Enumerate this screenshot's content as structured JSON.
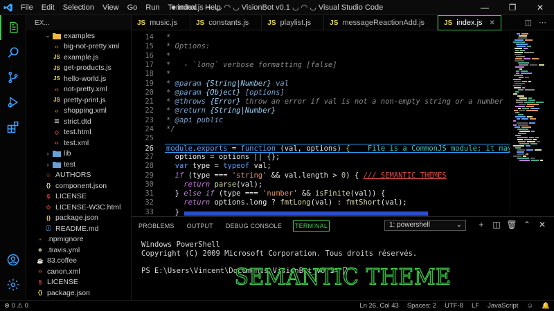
{
  "window": {
    "title": "● index.js — ◡ ◠ ◡ VisionBot v0.1 ◡ ◠ ◡ Visual Studio Code",
    "menu": [
      "File",
      "Edit",
      "Selection",
      "View",
      "Go",
      "Run",
      "Terminal",
      "Help"
    ]
  },
  "activity": {
    "items": [
      "files-icon",
      "search-icon",
      "source-control-icon",
      "run-debug-icon",
      "extensions-icon"
    ],
    "bottom": [
      "account-icon",
      "settings-gear-icon"
    ]
  },
  "explorer": {
    "header": "EX...",
    "rows": [
      {
        "label": "examples",
        "kind": "folder-open",
        "indent": 1
      },
      {
        "label": "big-not-pretty.xml",
        "kind": "xml",
        "indent": 2
      },
      {
        "label": "example.js",
        "kind": "js",
        "indent": 2
      },
      {
        "label": "get-products.js",
        "kind": "js",
        "indent": 2
      },
      {
        "label": "hello-world.js",
        "kind": "js",
        "indent": 2
      },
      {
        "label": "not-pretty.xml",
        "kind": "xml",
        "indent": 2
      },
      {
        "label": "pretty-print.js",
        "kind": "js",
        "indent": 2
      },
      {
        "label": "shopping.xml",
        "kind": "xml",
        "indent": 2
      },
      {
        "label": "strict.dtd",
        "kind": "dtd",
        "indent": 2
      },
      {
        "label": "test.html",
        "kind": "html",
        "indent": 2
      },
      {
        "label": "test.xml",
        "kind": "xml",
        "indent": 2
      },
      {
        "label": "lib",
        "kind": "folder",
        "indent": 1
      },
      {
        "label": "test",
        "kind": "folder",
        "indent": 1
      },
      {
        "label": "AUTHORS",
        "kind": "authors",
        "indent": 1
      },
      {
        "label": "component.json",
        "kind": "json",
        "indent": 1
      },
      {
        "label": "LICENSE",
        "kind": "license",
        "indent": 1
      },
      {
        "label": "LICENSE-W3C.html",
        "kind": "html",
        "indent": 1
      },
      {
        "label": "package.json",
        "kind": "json",
        "indent": 1
      },
      {
        "label": "README.md",
        "kind": "md",
        "indent": 1
      },
      {
        "label": ".npmignore",
        "kind": "npm",
        "indent": 0
      },
      {
        "label": ".travis.yml",
        "kind": "travis",
        "indent": 0
      },
      {
        "label": "83.coffee",
        "kind": "coffee",
        "indent": 0
      },
      {
        "label": "canon.xml",
        "kind": "xml",
        "indent": 0
      },
      {
        "label": "LICENSE",
        "kind": "license",
        "indent": 0
      },
      {
        "label": "package.json",
        "kind": "json",
        "indent": 0
      }
    ]
  },
  "tabs": [
    {
      "icon": "JS",
      "label": "music.js",
      "active": false
    },
    {
      "icon": "JS",
      "label": "constants.js",
      "active": false
    },
    {
      "icon": "JS",
      "label": "playlist.js",
      "active": false
    },
    {
      "icon": "JS",
      "label": "messageReactionAdd.js",
      "active": false
    },
    {
      "icon": "JS",
      "label": "index.js",
      "active": true
    }
  ],
  "editor": {
    "lines": [
      {
        "n": "14",
        "segs": [
          [
            "cm",
            "*"
          ]
        ]
      },
      {
        "n": "15",
        "segs": [
          [
            "cm",
            "* Options:"
          ]
        ]
      },
      {
        "n": "16",
        "segs": [
          [
            "cm",
            "*"
          ]
        ]
      },
      {
        "n": "17",
        "segs": [
          [
            "cm",
            "*   - `long` verbose formatting [false]"
          ]
        ]
      },
      {
        "n": "18",
        "segs": [
          [
            "cm",
            "*"
          ]
        ]
      },
      {
        "n": "19",
        "segs": [
          [
            "cm",
            "* "
          ],
          [
            "tg",
            "@param"
          ],
          [
            "cm",
            " "
          ],
          [
            "ty",
            "{String|Number}"
          ],
          [
            "cm",
            " "
          ],
          [
            "tg",
            "val"
          ]
        ]
      },
      {
        "n": "20",
        "segs": [
          [
            "cm",
            "* "
          ],
          [
            "tg",
            "@param"
          ],
          [
            "cm",
            " "
          ],
          [
            "ty",
            "{Object}"
          ],
          [
            "cm",
            " "
          ],
          [
            "tg",
            "[options]"
          ]
        ]
      },
      {
        "n": "21",
        "segs": [
          [
            "cm",
            "* "
          ],
          [
            "tg",
            "@throws"
          ],
          [
            "cm",
            " "
          ],
          [
            "ty",
            "{Error}"
          ],
          [
            "cm",
            " throw an error if val is not a non-empty string or a number"
          ]
        ]
      },
      {
        "n": "22",
        "segs": [
          [
            "cm",
            "* "
          ],
          [
            "tg",
            "@return"
          ],
          [
            "cm",
            " "
          ],
          [
            "ty",
            "{String|Number}"
          ]
        ]
      },
      {
        "n": "23",
        "segs": [
          [
            "cm",
            "* "
          ],
          [
            "tg",
            "@api"
          ],
          [
            "cm",
            " "
          ],
          [
            "tg",
            "public"
          ]
        ]
      },
      {
        "n": "24",
        "segs": [
          [
            "cm",
            "*/"
          ]
        ]
      },
      {
        "n": "25",
        "segs": []
      },
      {
        "n": "26",
        "cur": true,
        "segs": [
          [
            "kw",
            "module"
          ],
          [
            "id",
            "."
          ],
          [
            "kw",
            "exports"
          ],
          [
            "id",
            " = "
          ],
          [
            "kw",
            "function"
          ],
          [
            "id",
            " (val, options) "
          ],
          [
            "br",
            "{"
          ],
          [
            "hint",
            "    File is a CommonJS module; it may be c"
          ]
        ]
      },
      {
        "n": "27",
        "segs": [
          [
            "id",
            "  options = options || {};"
          ]
        ]
      },
      {
        "n": "28",
        "segs": [
          [
            "kw",
            "  var"
          ],
          [
            "id",
            " type = "
          ],
          [
            "kw",
            "typeof"
          ],
          [
            "id",
            " val;"
          ]
        ]
      },
      {
        "n": "29",
        "segs": [
          [
            "kwi",
            "  if"
          ],
          [
            "id",
            " (type === "
          ],
          [
            "st",
            "'string'"
          ],
          [
            "id",
            " && val.length > "
          ],
          [
            "nm",
            "0"
          ],
          [
            "id",
            ") { "
          ],
          [
            "sem",
            "/// SEMANTIC THEMES"
          ]
        ]
      },
      {
        "n": "30",
        "segs": [
          [
            "kwi",
            "    return"
          ],
          [
            "id",
            " "
          ],
          [
            "fn",
            "parse"
          ],
          [
            "id",
            "(val);"
          ]
        ]
      },
      {
        "n": "31",
        "segs": [
          [
            "id",
            "  } "
          ],
          [
            "kwi",
            "else if"
          ],
          [
            "id",
            " (type === "
          ],
          [
            "st",
            "'number'"
          ],
          [
            "id",
            " && "
          ],
          [
            "fn",
            "isFinite"
          ],
          [
            "id",
            "(val)) {"
          ]
        ]
      },
      {
        "n": "32",
        "segs": [
          [
            "kwi",
            "    return"
          ],
          [
            "id",
            " options.long ? "
          ],
          [
            "fn",
            "fmtLong"
          ],
          [
            "id",
            "(val) : "
          ],
          [
            "fn",
            "fmtShort"
          ],
          [
            "id",
            "(val);"
          ]
        ]
      },
      {
        "n": "33",
        "segs": [
          [
            "id",
            "  }"
          ]
        ]
      }
    ]
  },
  "panel": {
    "tabs": [
      "PROBLEMS",
      "OUTPUT",
      "DEBUG CONSOLE",
      "TERMINAL"
    ],
    "active_tab": "TERMINAL",
    "shell": "1: powershell",
    "terminal_lines": [
      "Windows PowerShell",
      "Copyright (C) 2009 Microsoft Corporation. Tous droits réservés.",
      "",
      "PS E:\\Users\\Vincent\\Documents\\VisionBot_v0.1> "
    ],
    "banner": "SEMANTIC THEME"
  },
  "status": {
    "problems": "⊗ 0  ⚠ 0",
    "position": "Ln 26, Col 43",
    "spaces": "Spaces: 2",
    "encoding": "UTF-8",
    "eol": "LF",
    "language": "JavaScript"
  },
  "colors": {
    "accent": "#3dcf4a",
    "cursor_line": "#2aa3ff",
    "scrollbar": "#2a4dd6"
  }
}
